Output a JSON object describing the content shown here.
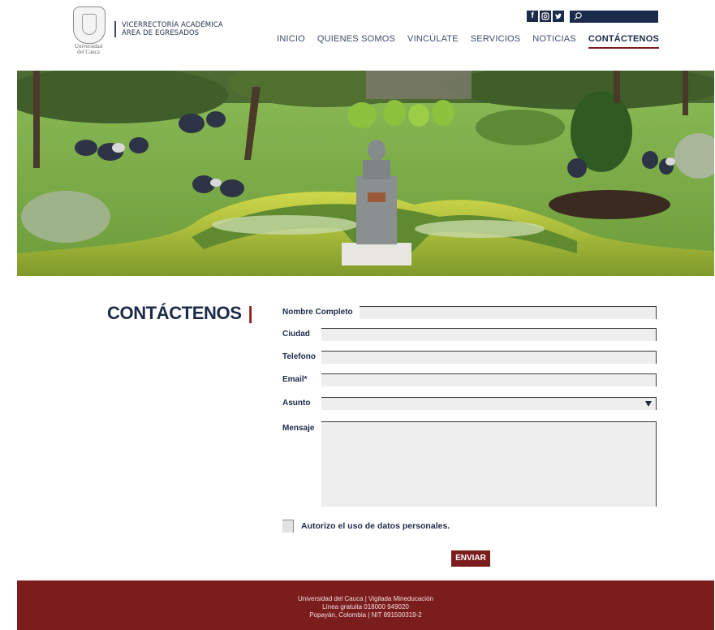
{
  "logo": {
    "text_line1": "Universidad",
    "text_line2": "del Cauca"
  },
  "header": {
    "dept_line1": "VICERRECTORÍA ACADÉMICA",
    "dept_line2": "ÁREA DE EGRESADOS",
    "social": [
      {
        "icon": "facebook-icon",
        "glyph": "f"
      },
      {
        "icon": "instagram-icon",
        "glyph": "◎"
      },
      {
        "icon": "twitter-icon",
        "glyph": "🐦"
      }
    ],
    "search": {
      "icon": "search-icon",
      "placeholder": ""
    }
  },
  "nav": {
    "items": [
      "INICIO",
      "QUIENES SOMOS",
      "VINCÚLATE",
      "SERVICIOS",
      "NOTICIAS",
      "CONTÁCTENOS"
    ],
    "active": "CONTÁCTENOS"
  },
  "page": {
    "title": "CONTÁCTENOS",
    "title_bar": "|"
  },
  "form": {
    "name_label": "Nombre Completo",
    "city_label": "Ciudad",
    "phone_label": "Telefono",
    "email_label": "Email*",
    "subject_label": "Asunto",
    "subject_value": "",
    "message_label": "Mensaje",
    "consent_label": "Autorizo el uso de datos personales.",
    "submit_label": "ENVIAR"
  },
  "footer": {
    "line1": "Universidad del Cauca | Vigilada Mineducación",
    "line2": "Línea gratuita 018000 949020",
    "line3": "Popayán, Colombia | NIT 891500319-2"
  },
  "colors": {
    "brand_red": "#7b1d1d",
    "navy": "#1b2b4b"
  }
}
